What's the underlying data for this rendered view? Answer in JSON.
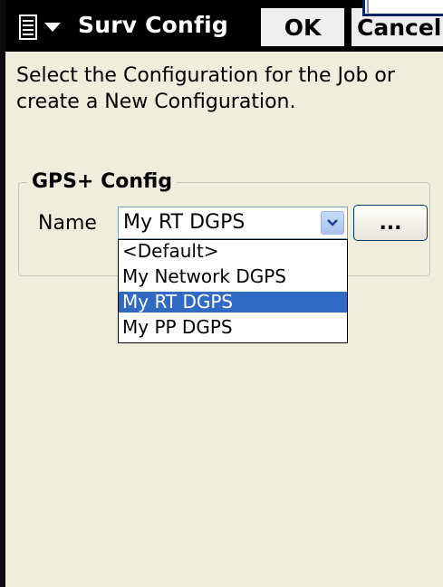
{
  "titlebar": {
    "title": "Surv Config",
    "ok_label": "OK",
    "cancel_label": "Cancel",
    "menu_icon": "start-menu-icon",
    "caret_icon": "caret-down-icon",
    "background": "#000000"
  },
  "instruction": "Select the Configuration for the Job or create a New Configuration.",
  "gps_group": {
    "legend": "GPS+ Config",
    "name_label": "Name",
    "selected_value": "My RT DGPS",
    "ellipsis_label": "...",
    "options": [
      "<Default>",
      "My Network DGPS",
      "My RT DGPS",
      "My PP DGPS"
    ],
    "selected_index": 2
  },
  "colors": {
    "window_bg": "#efeddc",
    "selection": "#316ac5"
  }
}
